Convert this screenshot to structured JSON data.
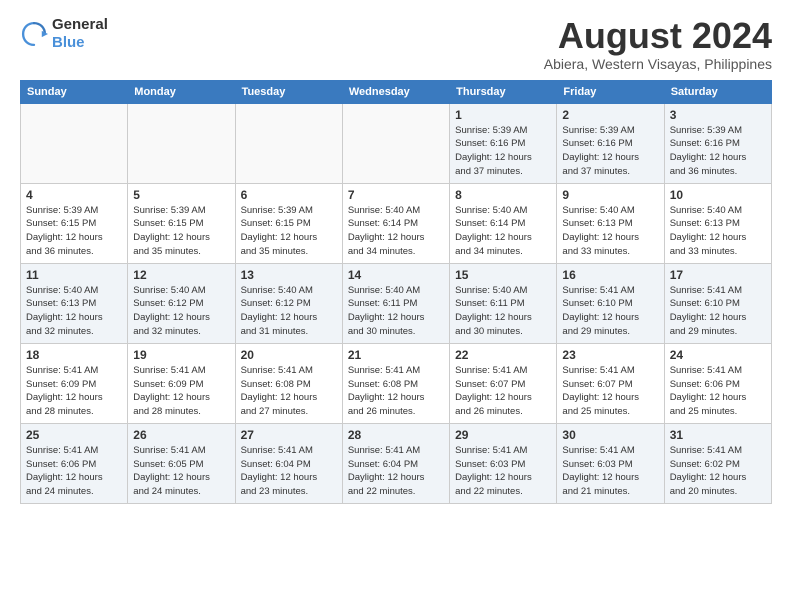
{
  "header": {
    "logo_general": "General",
    "logo_blue": "Blue",
    "title": "August 2024",
    "subtitle": "Abiera, Western Visayas, Philippines"
  },
  "days_of_week": [
    "Sunday",
    "Monday",
    "Tuesday",
    "Wednesday",
    "Thursday",
    "Friday",
    "Saturday"
  ],
  "weeks": [
    [
      {
        "day": "",
        "info": ""
      },
      {
        "day": "",
        "info": ""
      },
      {
        "day": "",
        "info": ""
      },
      {
        "day": "",
        "info": ""
      },
      {
        "day": "1",
        "info": "Sunrise: 5:39 AM\nSunset: 6:16 PM\nDaylight: 12 hours\nand 37 minutes."
      },
      {
        "day": "2",
        "info": "Sunrise: 5:39 AM\nSunset: 6:16 PM\nDaylight: 12 hours\nand 37 minutes."
      },
      {
        "day": "3",
        "info": "Sunrise: 5:39 AM\nSunset: 6:16 PM\nDaylight: 12 hours\nand 36 minutes."
      }
    ],
    [
      {
        "day": "4",
        "info": "Sunrise: 5:39 AM\nSunset: 6:15 PM\nDaylight: 12 hours\nand 36 minutes."
      },
      {
        "day": "5",
        "info": "Sunrise: 5:39 AM\nSunset: 6:15 PM\nDaylight: 12 hours\nand 35 minutes."
      },
      {
        "day": "6",
        "info": "Sunrise: 5:39 AM\nSunset: 6:15 PM\nDaylight: 12 hours\nand 35 minutes."
      },
      {
        "day": "7",
        "info": "Sunrise: 5:40 AM\nSunset: 6:14 PM\nDaylight: 12 hours\nand 34 minutes."
      },
      {
        "day": "8",
        "info": "Sunrise: 5:40 AM\nSunset: 6:14 PM\nDaylight: 12 hours\nand 34 minutes."
      },
      {
        "day": "9",
        "info": "Sunrise: 5:40 AM\nSunset: 6:13 PM\nDaylight: 12 hours\nand 33 minutes."
      },
      {
        "day": "10",
        "info": "Sunrise: 5:40 AM\nSunset: 6:13 PM\nDaylight: 12 hours\nand 33 minutes."
      }
    ],
    [
      {
        "day": "11",
        "info": "Sunrise: 5:40 AM\nSunset: 6:13 PM\nDaylight: 12 hours\nand 32 minutes."
      },
      {
        "day": "12",
        "info": "Sunrise: 5:40 AM\nSunset: 6:12 PM\nDaylight: 12 hours\nand 32 minutes."
      },
      {
        "day": "13",
        "info": "Sunrise: 5:40 AM\nSunset: 6:12 PM\nDaylight: 12 hours\nand 31 minutes."
      },
      {
        "day": "14",
        "info": "Sunrise: 5:40 AM\nSunset: 6:11 PM\nDaylight: 12 hours\nand 30 minutes."
      },
      {
        "day": "15",
        "info": "Sunrise: 5:40 AM\nSunset: 6:11 PM\nDaylight: 12 hours\nand 30 minutes."
      },
      {
        "day": "16",
        "info": "Sunrise: 5:41 AM\nSunset: 6:10 PM\nDaylight: 12 hours\nand 29 minutes."
      },
      {
        "day": "17",
        "info": "Sunrise: 5:41 AM\nSunset: 6:10 PM\nDaylight: 12 hours\nand 29 minutes."
      }
    ],
    [
      {
        "day": "18",
        "info": "Sunrise: 5:41 AM\nSunset: 6:09 PM\nDaylight: 12 hours\nand 28 minutes."
      },
      {
        "day": "19",
        "info": "Sunrise: 5:41 AM\nSunset: 6:09 PM\nDaylight: 12 hours\nand 28 minutes."
      },
      {
        "day": "20",
        "info": "Sunrise: 5:41 AM\nSunset: 6:08 PM\nDaylight: 12 hours\nand 27 minutes."
      },
      {
        "day": "21",
        "info": "Sunrise: 5:41 AM\nSunset: 6:08 PM\nDaylight: 12 hours\nand 26 minutes."
      },
      {
        "day": "22",
        "info": "Sunrise: 5:41 AM\nSunset: 6:07 PM\nDaylight: 12 hours\nand 26 minutes."
      },
      {
        "day": "23",
        "info": "Sunrise: 5:41 AM\nSunset: 6:07 PM\nDaylight: 12 hours\nand 25 minutes."
      },
      {
        "day": "24",
        "info": "Sunrise: 5:41 AM\nSunset: 6:06 PM\nDaylight: 12 hours\nand 25 minutes."
      }
    ],
    [
      {
        "day": "25",
        "info": "Sunrise: 5:41 AM\nSunset: 6:06 PM\nDaylight: 12 hours\nand 24 minutes."
      },
      {
        "day": "26",
        "info": "Sunrise: 5:41 AM\nSunset: 6:05 PM\nDaylight: 12 hours\nand 24 minutes."
      },
      {
        "day": "27",
        "info": "Sunrise: 5:41 AM\nSunset: 6:04 PM\nDaylight: 12 hours\nand 23 minutes."
      },
      {
        "day": "28",
        "info": "Sunrise: 5:41 AM\nSunset: 6:04 PM\nDaylight: 12 hours\nand 22 minutes."
      },
      {
        "day": "29",
        "info": "Sunrise: 5:41 AM\nSunset: 6:03 PM\nDaylight: 12 hours\nand 22 minutes."
      },
      {
        "day": "30",
        "info": "Sunrise: 5:41 AM\nSunset: 6:03 PM\nDaylight: 12 hours\nand 21 minutes."
      },
      {
        "day": "31",
        "info": "Sunrise: 5:41 AM\nSunset: 6:02 PM\nDaylight: 12 hours\nand 20 minutes."
      }
    ]
  ]
}
